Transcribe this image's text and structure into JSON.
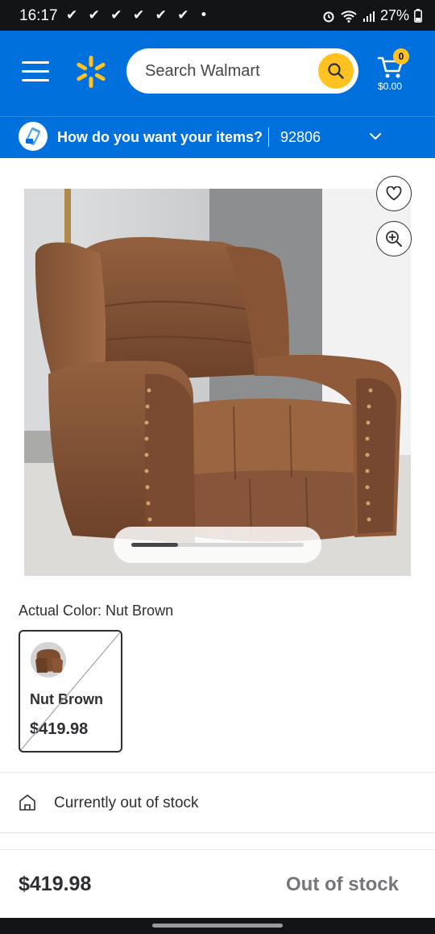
{
  "status_bar": {
    "time": "16:17",
    "checks": "✔ ✔ ✔ ✔ ✔ ✔ •",
    "battery": "27%"
  },
  "header": {
    "search_placeholder": "Search Walmart",
    "cart_count": "0",
    "cart_total": "$0.00",
    "accent_color": "#0071dc",
    "spark_color": "#ffc220"
  },
  "delivery": {
    "question": "How do you want your items?",
    "zip": "92806"
  },
  "gallery": {
    "carousel_progress": 0.27
  },
  "variant": {
    "label": "Actual Color: Nut Brown",
    "option_name": "Nut Brown",
    "option_price": "$419.98"
  },
  "availability": {
    "stock_text": "Currently out of stock"
  },
  "bottom_bar": {
    "price": "$419.98",
    "button_label": "Out of stock"
  }
}
